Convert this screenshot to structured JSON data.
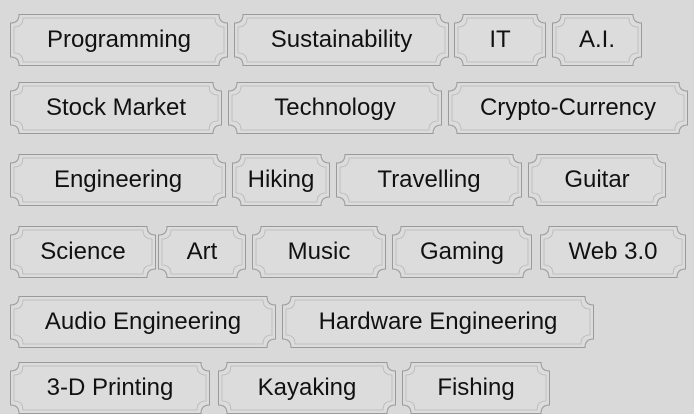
{
  "tags": [
    {
      "name": "tag-programming",
      "label": "Programming"
    },
    {
      "name": "tag-sustainability",
      "label": "Sustainability"
    },
    {
      "name": "tag-it",
      "label": "IT"
    },
    {
      "name": "tag-ai",
      "label": "A.I."
    },
    {
      "name": "tag-stock-market",
      "label": "Stock Market"
    },
    {
      "name": "tag-technology",
      "label": "Technology"
    },
    {
      "name": "tag-crypto-currency",
      "label": "Crypto-Currency"
    },
    {
      "name": "tag-engineering",
      "label": "Engineering"
    },
    {
      "name": "tag-hiking",
      "label": "Hiking"
    },
    {
      "name": "tag-travelling",
      "label": "Travelling"
    },
    {
      "name": "tag-guitar",
      "label": "Guitar"
    },
    {
      "name": "tag-science",
      "label": "Science"
    },
    {
      "name": "tag-art",
      "label": "Art"
    },
    {
      "name": "tag-music",
      "label": "Music"
    },
    {
      "name": "tag-gaming",
      "label": "Gaming"
    },
    {
      "name": "tag-web3",
      "label": "Web 3.0"
    },
    {
      "name": "tag-audio-engineering",
      "label": "Audio Engineering"
    },
    {
      "name": "tag-hardware-engineering",
      "label": "Hardware Engineering"
    },
    {
      "name": "tag-3d-printing",
      "label": "3-D Printing"
    },
    {
      "name": "tag-kayaking",
      "label": "Kayaking"
    },
    {
      "name": "tag-fishing",
      "label": "Fishing"
    }
  ],
  "colors": {
    "background": "#d9d9d9",
    "frame_stroke": "#9a9a9a",
    "frame_fill": "#dcdcdc",
    "text": "#111111"
  }
}
